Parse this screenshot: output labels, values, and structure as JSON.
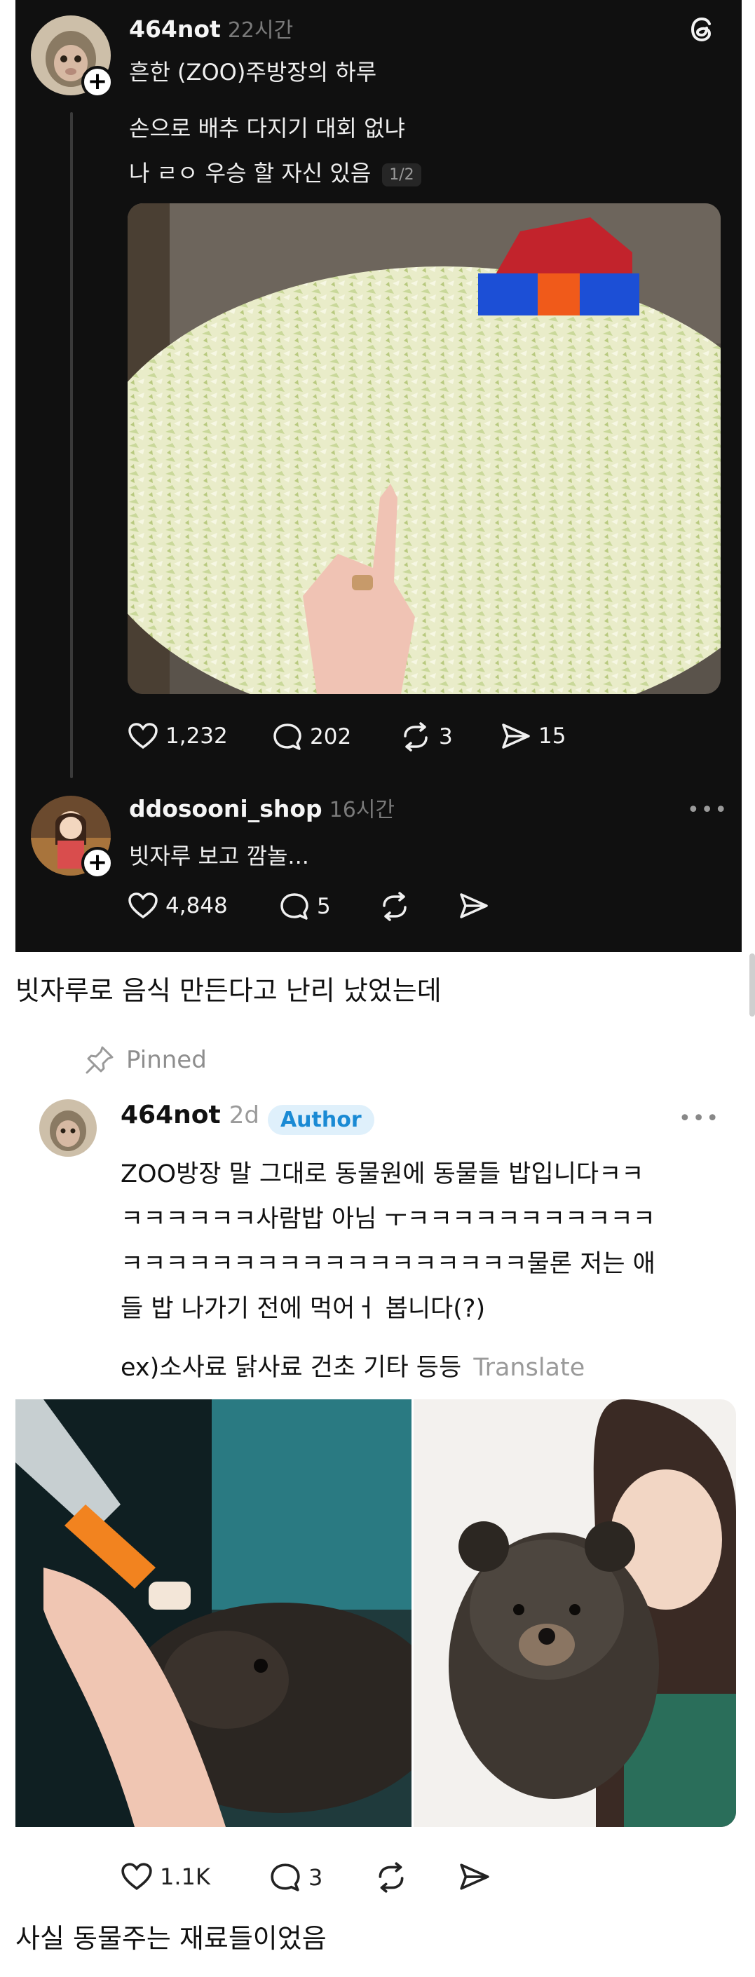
{
  "threads_post": {
    "author": "464not",
    "time": "22시간",
    "text_lines": [
      "흔한 (ZOO)주방장의 하루",
      "손으로 배추 다지기 대회 없냐",
      "나 ㄹㅇ 우승 할 자신 있음"
    ],
    "pager": "1/2",
    "stats": {
      "likes": "1,232",
      "comments": "202",
      "reposts": "3",
      "shares": "15"
    }
  },
  "threads_reply": {
    "author": "ddosooni_shop",
    "time": "16시간",
    "text": "빗자루 보고 깜놀...",
    "stats": {
      "likes": "4,848",
      "comments": "5"
    }
  },
  "caption_1": "빗자루로 음식 만든다고 난리 났었는데",
  "pinned_post": {
    "pinned_label": "Pinned",
    "author": "464not",
    "time": "2d",
    "badge": "Author",
    "text_lines": [
      "ZOO방장 말 그대로 동물원에 동물들 밥입니다ㅋㅋ",
      "ㅋㅋㅋㅋㅋㅋ사람밥 아님 ㅜㅋㅋㅋㅋㅋㅋㅋㅋㅋㅋㅋ",
      "ㅋㅋㅋㅋㅋㅋㅋㅋㅋㅋㅋㅋㅋㅋㅋㅋㅋㅋ물론 저는 애",
      "들 밥 나가기 전에 먹어ㅓ 봅니다(?)"
    ],
    "extra_line": "ex)소사료 닭사료 건초 기타 등등",
    "translate": "Translate",
    "stats": {
      "likes": "1.1K",
      "comments": "3"
    }
  },
  "caption_2": "사실 동물주는 재료들이었음",
  "colors": {
    "dark_bg": "#101010",
    "link_blue": "#1a8ad4",
    "badge_bg": "#dff0fb"
  }
}
